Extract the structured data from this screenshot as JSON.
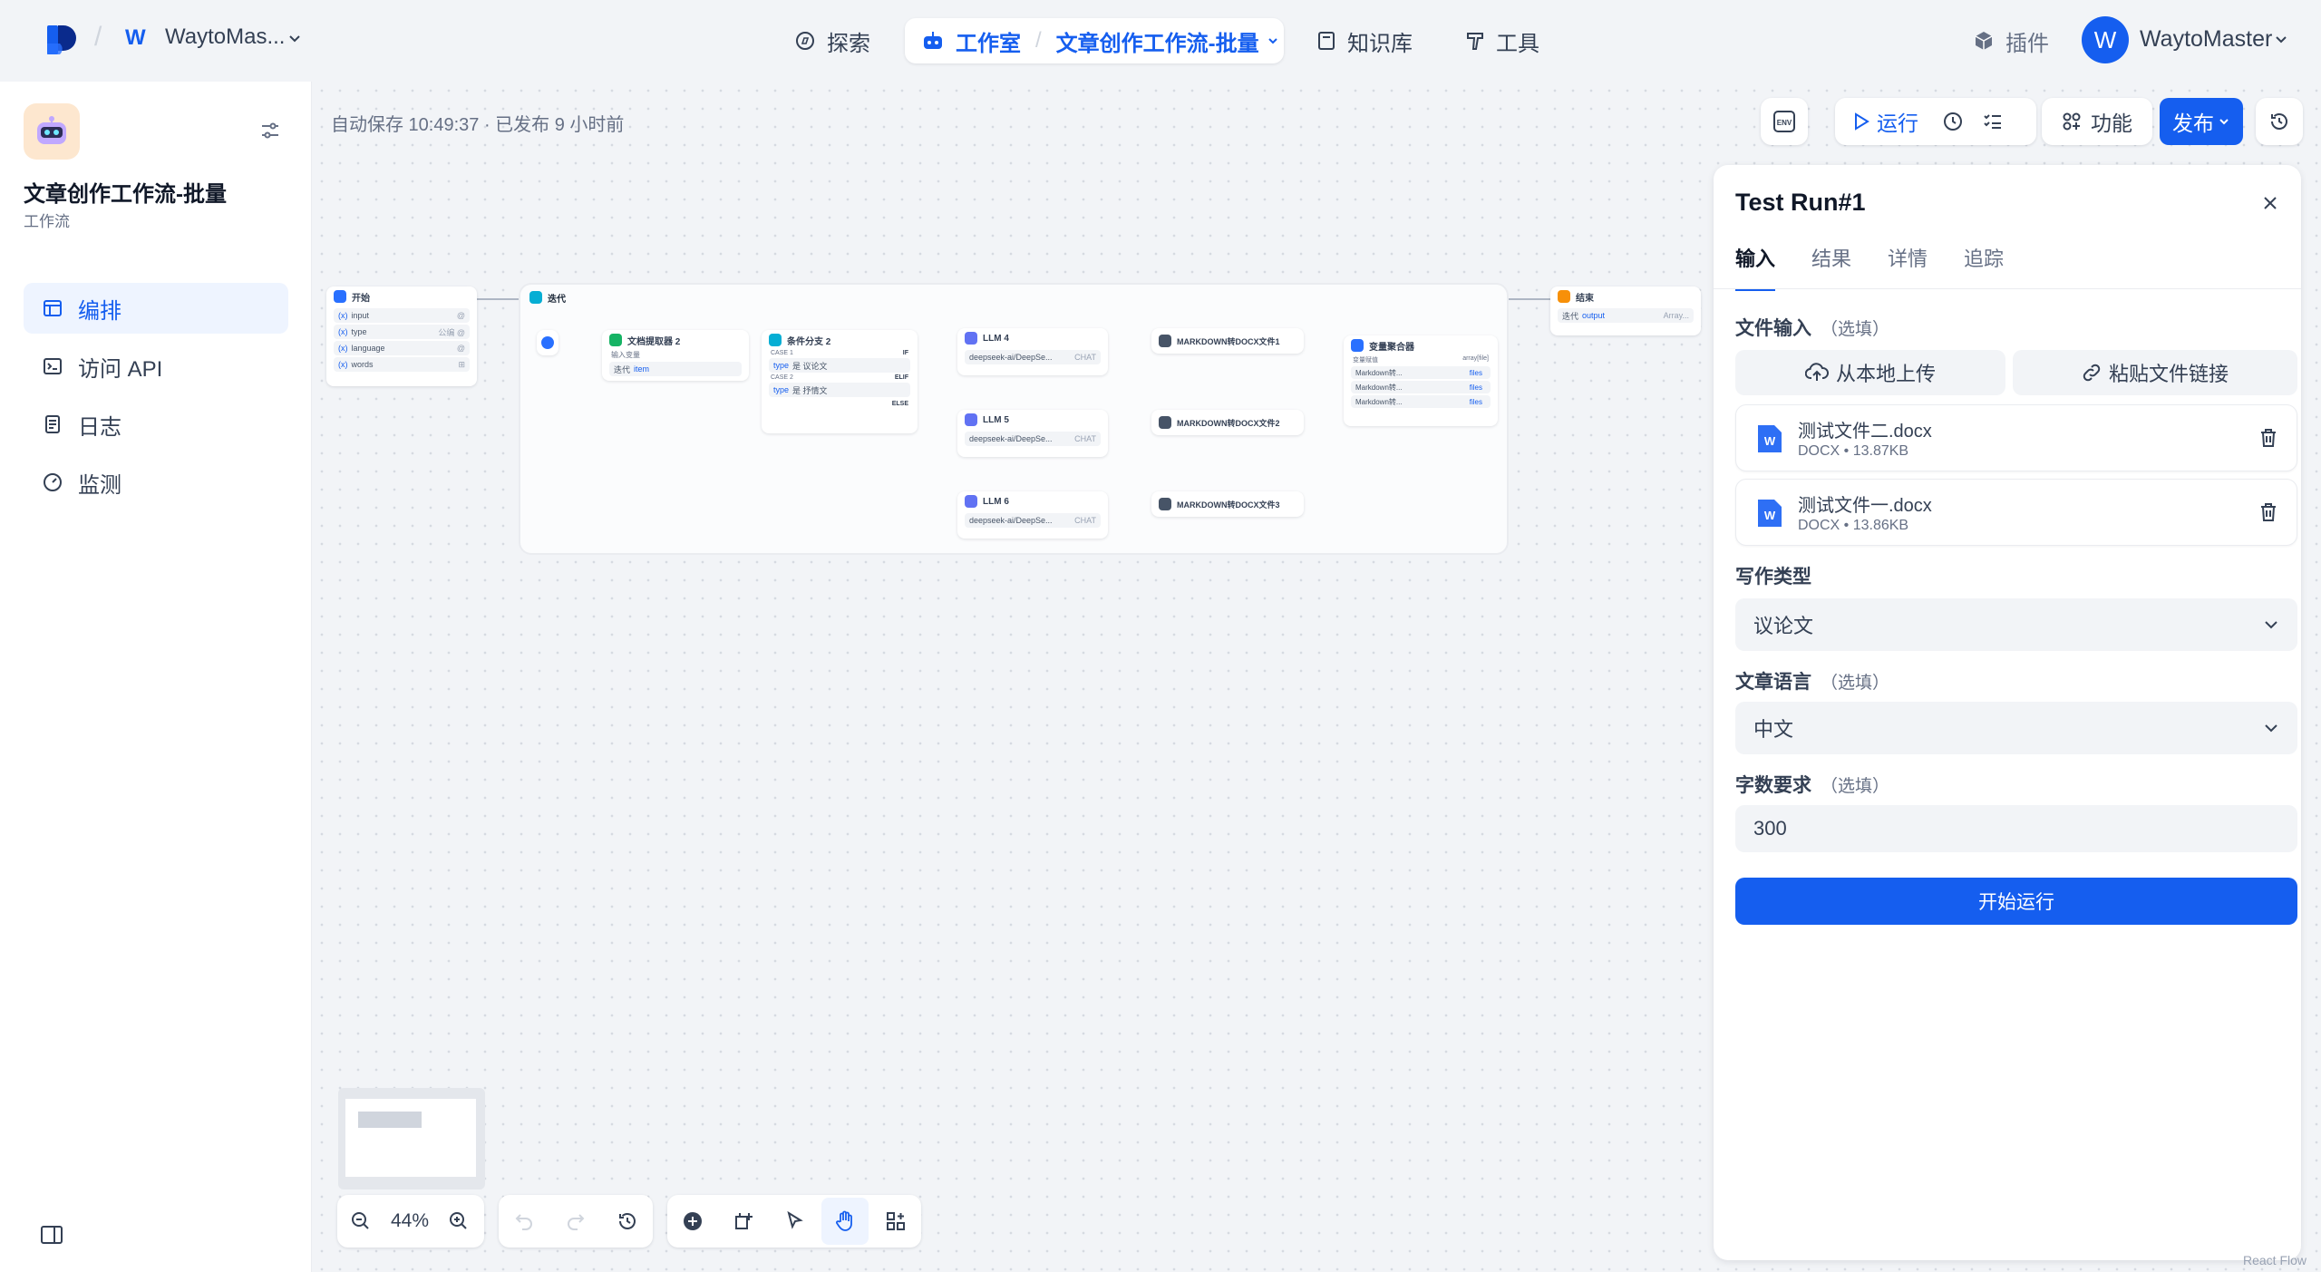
{
  "workspace": {
    "avatar": "W",
    "name": "WaytoMas..."
  },
  "nav": {
    "explore": "探索",
    "studio": "工作室",
    "current_app": "文章创作工作流-批量",
    "knowledge": "知识库",
    "tools": "工具",
    "plugins": "插件"
  },
  "user": {
    "avatar": "W",
    "name": "WaytoMaster"
  },
  "app": {
    "title": "文章创作工作流-批量",
    "type": "工作流"
  },
  "sidebar": {
    "items": [
      {
        "label": "编排"
      },
      {
        "label": "访问 API"
      },
      {
        "label": "日志"
      },
      {
        "label": "监测"
      }
    ]
  },
  "canvas": {
    "autosave": "自动保存 10:49:37 · 已发布 9 小时前",
    "env": "ENV",
    "run": "运行",
    "features": "功能",
    "publish": "发布",
    "zoom": "44%"
  },
  "nodes": {
    "start": {
      "title": "开始",
      "vars": [
        {
          "name": "input",
          "t": "@"
        },
        {
          "name": "type",
          "t": "公编 @"
        },
        {
          "name": "language",
          "t": "@"
        },
        {
          "name": "words",
          "t": "⊞"
        }
      ]
    },
    "iteration": {
      "title": "迭代"
    },
    "extractor": {
      "title": "文档提取器 2",
      "sub": "输入变量",
      "var": "迭代",
      "item": "item"
    },
    "ifelse": {
      "title": "条件分支 2",
      "case1": "CASE 1",
      "if": "IF",
      "cond1": "type",
      "op1": "是 议论文",
      "case2": "CASE 2",
      "elif": "ELIF",
      "cond2": "type",
      "op2": "是 抒情文",
      "else": "ELSE"
    },
    "llm4": {
      "title": "LLM 4",
      "model": "deepseek-ai/DeepSe...",
      "tag": "CHAT"
    },
    "llm5": {
      "title": "LLM 5",
      "model": "deepseek-ai/DeepSe...",
      "tag": "CHAT"
    },
    "llm6": {
      "title": "LLM 6",
      "model": "deepseek-ai/DeepSe...",
      "tag": "CHAT"
    },
    "md1": {
      "title": "MARKDOWN转DOCX文件1"
    },
    "md2": {
      "title": "MARKDOWN转DOCX文件2"
    },
    "md3": {
      "title": "MARKDOWN转DOCX文件3"
    },
    "aggregator": {
      "title": "变量聚合器",
      "sub": "变量赋值",
      "type": "array[file]",
      "rows": [
        "Markdown转...",
        "Markdown转...",
        "Markdown转..."
      ],
      "files": "files"
    },
    "end": {
      "title": "结束",
      "var": "迭代",
      "output": "output",
      "type": "Array..."
    }
  },
  "panel": {
    "title": "Test Run#1",
    "tabs": [
      "输入",
      "结果",
      "详情",
      "追踪"
    ],
    "file_input": {
      "label": "文件输入",
      "optional": "（选填）"
    },
    "upload_local": "从本地上传",
    "paste_link": "粘贴文件链接",
    "files": [
      {
        "name": "测试文件二.docx",
        "meta": "DOCX • 13.87KB"
      },
      {
        "name": "测试文件一.docx",
        "meta": "DOCX • 13.86KB"
      }
    ],
    "writing_type": {
      "label": "写作类型",
      "value": "议论文"
    },
    "language": {
      "label": "文章语言",
      "optional": "（选填）",
      "value": "中文"
    },
    "words": {
      "label": "字数要求",
      "optional": "（选填）",
      "value": "300"
    },
    "run_button": "开始运行"
  },
  "attribution": "React Flow",
  "colors": {
    "accent": "#155eef",
    "bg": "#f2f4f7"
  }
}
